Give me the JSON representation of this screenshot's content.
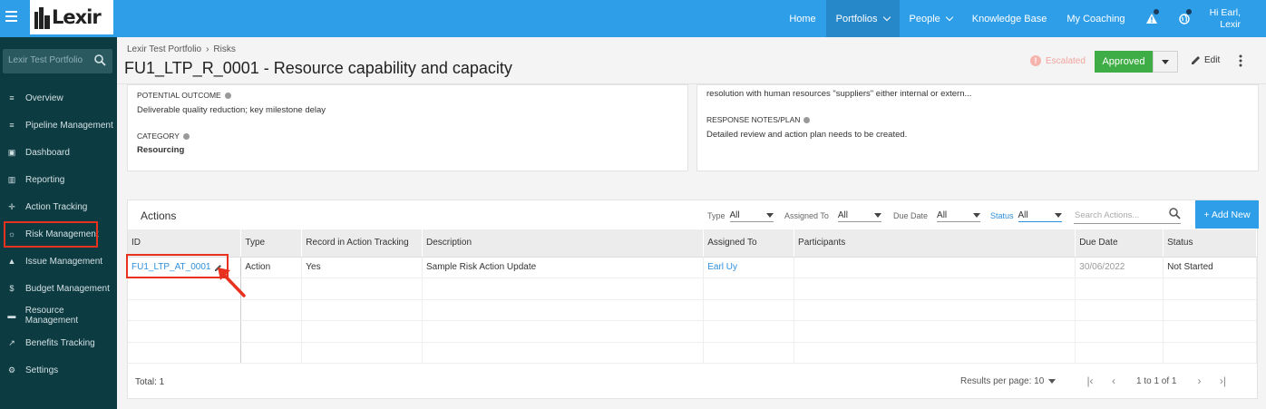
{
  "topbar": {
    "logo_text": "Lexir",
    "nav": [
      {
        "label": "Home",
        "active": false,
        "dropdown": false
      },
      {
        "label": "Portfolios",
        "active": true,
        "dropdown": true
      },
      {
        "label": "People",
        "active": false,
        "dropdown": true
      },
      {
        "label": "Knowledge Base",
        "active": false,
        "dropdown": false
      },
      {
        "label": "My Coaching",
        "active": false,
        "dropdown": false
      }
    ],
    "icons": [
      "warning-icon",
      "globe-icon"
    ],
    "user_greeting": "Hi Earl,",
    "user_org": "Lexir"
  },
  "sidebar": {
    "search_placeholder": "Lexir Test Portfolio",
    "items": [
      {
        "label": "Overview",
        "icon": "list-icon"
      },
      {
        "label": "Pipeline Management",
        "icon": "list-icon"
      },
      {
        "label": "Dashboard",
        "icon": "dashboard-icon"
      },
      {
        "label": "Reporting",
        "icon": "bar-chart-icon"
      },
      {
        "label": "Action Tracking",
        "icon": "crosshair-icon"
      },
      {
        "label": "Risk Management",
        "icon": "sun-icon"
      },
      {
        "label": "Issue Management",
        "icon": "warning-icon"
      },
      {
        "label": "Budget Management",
        "icon": "dollar-icon"
      },
      {
        "label": "Resource Management",
        "icon": "folder-icon"
      },
      {
        "label": "Benefits Tracking",
        "icon": "line-chart-icon"
      },
      {
        "label": "Settings",
        "icon": "gear-icon"
      }
    ]
  },
  "header": {
    "breadcrumb": [
      "Lexir Test Portfolio",
      "Risks"
    ],
    "title": "FU1_LTP_R_0001 - Resource capability and capacity",
    "escalated_label": "Escalated",
    "status_button": "Approved",
    "edit_label": "Edit"
  },
  "details": {
    "potential_outcome_label": "POTENTIAL OUTCOME",
    "potential_outcome_value": "Deliverable quality reduction; key milestone delay",
    "category_label": "CATEGORY",
    "category_value": "Resourcing",
    "right_cut_text": "resolution with human resources \"suppliers\" either internal or extern...",
    "response_label": "RESPONSE NOTES/PLAN",
    "response_value": "Detailed review and action plan needs to be created."
  },
  "actions": {
    "title": "Actions",
    "filters": [
      {
        "label": "Type",
        "value": "All"
      },
      {
        "label": "Assigned To",
        "value": "All"
      },
      {
        "label": "Due Date",
        "value": "All"
      },
      {
        "label": "Status",
        "value": "All"
      }
    ],
    "search_placeholder": "Search Actions...",
    "add_button": "+ Add New",
    "columns": [
      "ID",
      "Type",
      "Record in Action Tracking",
      "Description",
      "Assigned To",
      "Participants",
      "Due Date",
      "Status"
    ],
    "rows": [
      {
        "id": "FU1_LTP_AT_0001",
        "type": "Action",
        "record": "Yes",
        "description": "Sample Risk Action Update",
        "assigned_to": "Earl Uy",
        "participants": "",
        "due_date": "30/06/2022",
        "status": "Not Started"
      }
    ],
    "total": "Total: 1",
    "results_per_page": "Results per page: 10",
    "page_info": "1 to 1 of 1"
  },
  "colors": {
    "topbar": "#2e9ee8",
    "sidebar": "#0d3b42",
    "approved": "#3fad45",
    "highlight": "#e8321f",
    "link": "#2e8fd9"
  }
}
